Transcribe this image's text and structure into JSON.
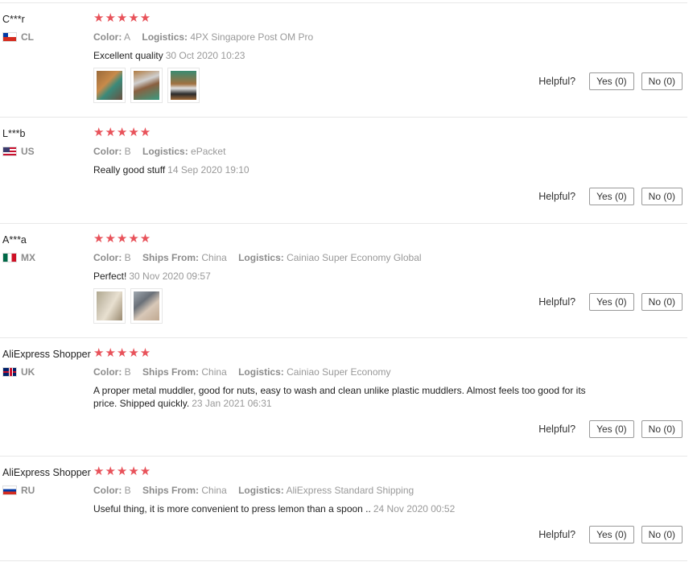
{
  "helpful_label": "Helpful?",
  "reviews": [
    {
      "user": "C***r",
      "country": "CL",
      "stars": "★★★★★",
      "meta": [
        {
          "label": "Color:",
          "value": "A"
        },
        {
          "label": "Logistics:",
          "value": "4PX Singapore Post OM Pro"
        }
      ],
      "text": "Excellent quality",
      "date": "30 Oct 2020 10:23",
      "yes": "Yes (0)",
      "no": "No (0)"
    },
    {
      "user": "L***b",
      "country": "US",
      "stars": "★★★★★",
      "meta": [
        {
          "label": "Color:",
          "value": "B"
        },
        {
          "label": "Logistics:",
          "value": "ePacket"
        }
      ],
      "text": "Really good stuff",
      "date": "14 Sep 2020 19:10",
      "yes": "Yes (0)",
      "no": "No (0)"
    },
    {
      "user": "A***a",
      "country": "MX",
      "stars": "★★★★★",
      "meta": [
        {
          "label": "Color:",
          "value": "B"
        },
        {
          "label": "Ships From:",
          "value": "China"
        },
        {
          "label": "Logistics:",
          "value": "Cainiao Super Economy Global"
        }
      ],
      "text": "Perfect!",
      "date": "30 Nov 2020 09:57",
      "yes": "Yes (0)",
      "no": "No (0)"
    },
    {
      "user": "AliExpress Shopper",
      "country": "UK",
      "stars": "★★★★★",
      "meta": [
        {
          "label": "Color:",
          "value": "B"
        },
        {
          "label": "Ships From:",
          "value": "China"
        },
        {
          "label": "Logistics:",
          "value": "Cainiao Super Economy"
        }
      ],
      "text": "A proper metal muddler, good for nuts, easy to wash and clean unlike plastic muddlers. Almost feels too good for its price. Shipped quickly.",
      "date": "23 Jan 2021 06:31",
      "yes": "Yes (0)",
      "no": "No (0)"
    },
    {
      "user": "AliExpress Shopper",
      "country": "RU",
      "stars": "★★★★★",
      "meta": [
        {
          "label": "Color:",
          "value": "B"
        },
        {
          "label": "Ships From:",
          "value": "China"
        },
        {
          "label": "Logistics:",
          "value": "AliExpress Standard Shipping"
        }
      ],
      "text": "Useful thing, it is more convenient to press lemon than a spoon ..",
      "date": "24 Nov 2020 00:52",
      "yes": "Yes (0)",
      "no": "No (0)"
    }
  ]
}
